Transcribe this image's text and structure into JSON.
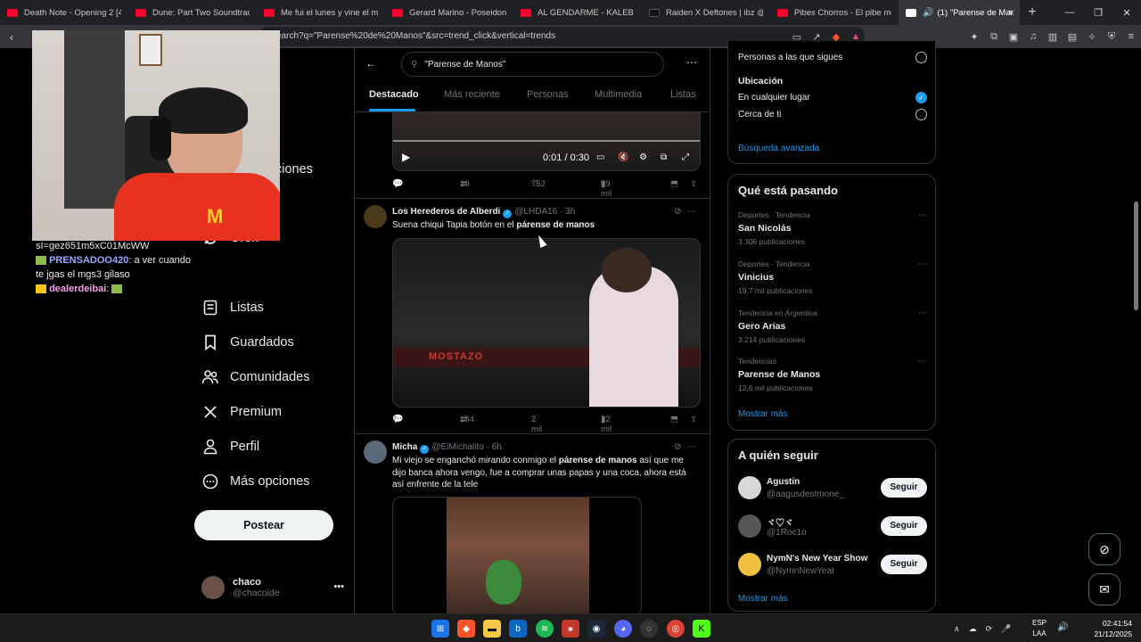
{
  "browser": {
    "tabs": [
      {
        "title": "Death Note - Opening 2 [4K 60",
        "icon": "youtube"
      },
      {
        "title": "Dune: Part Two Soundtrack | Ar",
        "icon": "youtube"
      },
      {
        "title": "Me fui el lunes y vine el martes",
        "icon": "youtube"
      },
      {
        "title": "Gerard Marino - Poseidon's Wr",
        "icon": "youtube"
      },
      {
        "title": "AL GENDARME - KALEB DI MA",
        "icon": "youtube"
      },
      {
        "title": "Raiden X Deftones | ibz @The R",
        "icon": "tiktok"
      },
      {
        "title": "Pibes Chorros - El pibe moco| ",
        "icon": "youtube"
      },
      {
        "title": "(1) \"Parense de Manos\"",
        "icon": "x",
        "active": true
      }
    ],
    "new_tab": "+",
    "url": "earch?q=\"Parense%20de%20Manos\"&src=trend_click&vertical=trends"
  },
  "chat": {
    "line1": "sI=gez651m5xC01McWW",
    "line2_user": "PRENSADOO420",
    "line2_text": ": a ver cuando te jgas el mgs3 gilaso",
    "line3_user": "dealerdeibai",
    "line3_text": ":"
  },
  "nav": {
    "hidden_label": "ciones",
    "partial_label": "Guardar",
    "items": [
      {
        "label": "Grok",
        "icon": "grok-icon"
      },
      {
        "label": "Listas",
        "icon": "list-icon"
      },
      {
        "label": "Guardados",
        "icon": "bookmark-icon"
      },
      {
        "label": "Comunidades",
        "icon": "communities-icon"
      },
      {
        "label": "Premium",
        "icon": "x-logo-icon"
      },
      {
        "label": "Perfil",
        "icon": "profile-icon"
      },
      {
        "label": "Más opciones",
        "icon": "more-options-icon"
      }
    ],
    "post_label": "Postear",
    "account": {
      "name": "chaco",
      "handle": "@chacoide"
    }
  },
  "search": {
    "query": "\"Parense de Manos\"",
    "tabs": [
      "Destacado",
      "Más reciente",
      "Personas",
      "Multimedia",
      "Listas"
    ],
    "active_tab": "Destacado"
  },
  "tweets": [
    {
      "video_time": "0:01 / 0:30",
      "replies": "",
      "retweets": "39",
      "likes": "752",
      "views": "59 mil"
    },
    {
      "name": "Los Herederos de Alberdi",
      "handle": "@LHDA16",
      "time": "· 3h",
      "text_prefix": "Suena chiqui Tapia botón en el ",
      "text_bold": "párense de manos",
      "media_caption": "MOSTAZO",
      "replies": "7",
      "retweets": "184",
      "likes": "2 mil",
      "views": "22 mil"
    },
    {
      "name": "Micha",
      "handle": "@ElMichalito",
      "time": "· 6h",
      "text_prefix": "Mi viejo se enganchó mirando conmigo el ",
      "text_bold": "párense de manos",
      "text_suffix": " así que me dijo banca ahora vengo, fue a comprar unas papas y una coca, ahora está así enfrente de la tele"
    }
  ],
  "filters": {
    "people_label": "Personas a las que sigues",
    "location_title": "Ubicación",
    "anywhere_label": "En cualquier lugar",
    "near_label": "Cerca de ti",
    "advanced_link": "Búsqueda avanzada"
  },
  "trending": {
    "title": "Qué está pasando",
    "items": [
      {
        "meta": "Deportes · Tendencia",
        "name": "San Nicolás",
        "count": "3.306 publicaciones"
      },
      {
        "meta": "Deportes · Tendencia",
        "name": "Vinicius",
        "count": "19,7 mil publicaciones"
      },
      {
        "meta": "Tendencia en Argentina",
        "name": "Gero Arias",
        "count": "3.214 publicaciones"
      },
      {
        "meta": "Tendencias",
        "name": "Parense de Manos",
        "count": "12,6 mil publicaciones"
      }
    ],
    "show_more": "Mostrar más"
  },
  "who_to_follow": {
    "title": "A quién seguir",
    "items": [
      {
        "name": "Agustin",
        "handle": "@aagusdesImone_",
        "button": "Seguir"
      },
      {
        "name": "ヾ♡ヾ",
        "handle": "@1Roc1o",
        "button": "Seguir"
      },
      {
        "name": "NymN's New Year Show",
        "handle": "@NymnNewYear",
        "button": "Seguir"
      }
    ],
    "show_more": "Mostrar más"
  },
  "taskbar": {
    "lang_top": "ESP",
    "lang_bottom": "LAA",
    "time": "02:41:54",
    "date": "21/12/2025"
  },
  "colors": {
    "accent": "#1d9bf0",
    "background": "#000000",
    "border": "#2f3336",
    "muted_text": "#71767b"
  }
}
